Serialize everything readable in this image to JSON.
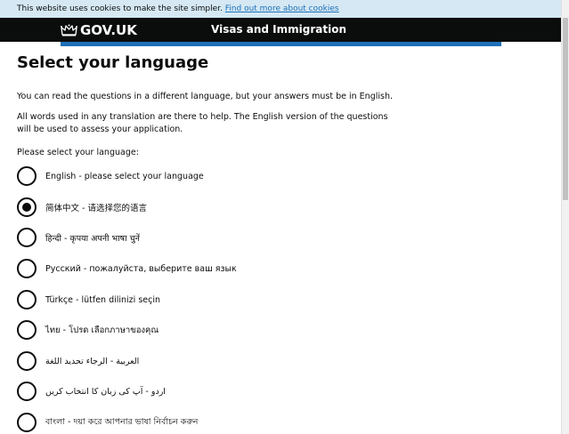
{
  "cookie_banner": {
    "text": "This website uses cookies to make the site simpler.",
    "link": "Find out more about cookies"
  },
  "header": {
    "logo_text": "GOV.UK",
    "service_name": "Visas and Immigration",
    "logo_icon": "crown-icon"
  },
  "main": {
    "title": "Select your language",
    "intro_1": "You can read the questions in a different language, but your answers must be in English.",
    "intro_2": "All words used in any translation are there to help. The English version of the questions will be used to assess your application.",
    "legend": "Please select your language:",
    "selected_index": 1,
    "options": [
      {
        "label": "English - please select your language"
      },
      {
        "label": "简体中文 - 请选择您的语言"
      },
      {
        "label": "हिन्दी - कृपया अपनी भाषा चुनें"
      },
      {
        "label": "Русский - пожалуйста, выберите ваш язык"
      },
      {
        "label": "Türkçe - lütfen dilinizi seçin"
      },
      {
        "label": "ไทย - โปรด เลือกภาษาของคุณ"
      },
      {
        "label": "العربية - الرجاء تحديد اللغة"
      },
      {
        "label": "اردو - آپ کی زبان کا انتخاب کریں"
      },
      {
        "label": "বাংলা - দয়া করে আপনার ভাষা নির্বাচন করুন"
      }
    ]
  },
  "colors": {
    "header_bg": "#0b0c0c",
    "accent_blue": "#1d70b8",
    "cookie_bg": "#d5e8f3",
    "text": "#0b0c0c"
  }
}
